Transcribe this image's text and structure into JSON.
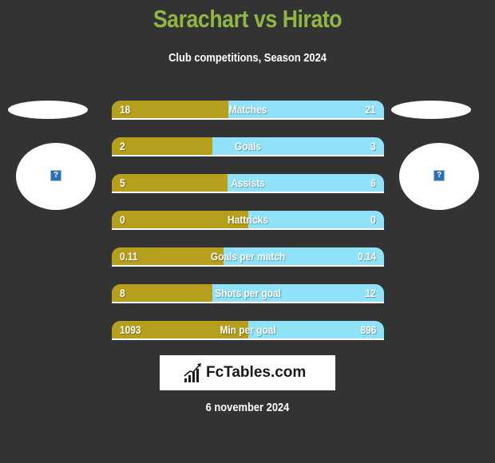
{
  "header": {
    "title": "Sarachart vs Hirato",
    "subtitle": "Club competitions, Season 2024"
  },
  "teams": {
    "left": {
      "name": "Sarachart",
      "logo_icon": "missing-image-icon"
    },
    "right": {
      "name": "Hirato",
      "logo_icon": "missing-image-icon"
    }
  },
  "colors": {
    "left_bar": "#b59f1c",
    "right_bar": "#8fe2f8",
    "title": "#8fb744",
    "background": "#333333"
  },
  "chart_data": {
    "type": "bar",
    "title": "Sarachart vs Hirato",
    "subtitle": "Club competitions, Season 2024",
    "categories": [
      "Matches",
      "Goals",
      "Assists",
      "Hattricks",
      "Goals per match",
      "Shots per goal",
      "Min per goal"
    ],
    "series": [
      {
        "name": "Sarachart",
        "values": [
          18,
          2,
          5,
          0,
          0.11,
          8,
          1093
        ],
        "labels": [
          "18",
          "2",
          "5",
          "0",
          "0.11",
          "8",
          "1093"
        ]
      },
      {
        "name": "Hirato",
        "values": [
          21,
          3,
          6,
          0,
          0.14,
          12,
          896
        ],
        "labels": [
          "21",
          "3",
          "6",
          "0",
          "0.14",
          "12",
          "896"
        ]
      }
    ],
    "left_share": [
      0.4286,
      0.3704,
      0.4265,
      0.5,
      0.4118,
      0.3704,
      0.5
    ]
  },
  "footer": {
    "brand": "FcTables.com",
    "date": "6 november 2024"
  }
}
